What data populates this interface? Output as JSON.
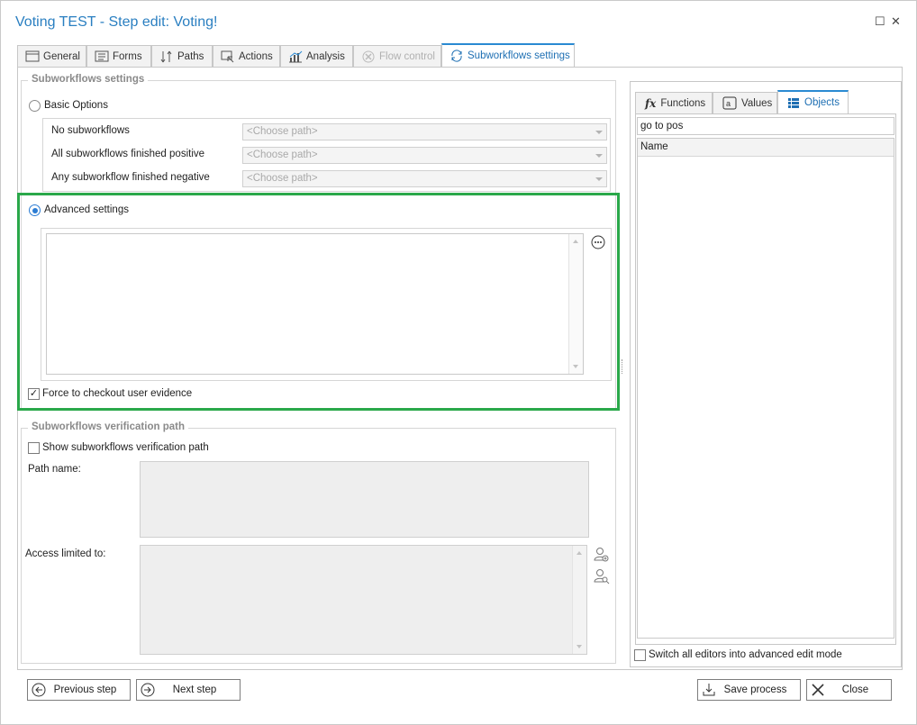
{
  "window": {
    "title": "Voting TEST - Step edit: Voting!",
    "maximize_glyph": "☐",
    "close_glyph": "✕"
  },
  "tabs": [
    {
      "label": "General",
      "icon": "window-icon",
      "state": "normal"
    },
    {
      "label": "Forms",
      "icon": "form-icon",
      "state": "normal"
    },
    {
      "label": "Paths",
      "icon": "paths-icon",
      "state": "normal"
    },
    {
      "label": "Actions",
      "icon": "actions-icon",
      "state": "normal"
    },
    {
      "label": "Analysis",
      "icon": "analysis-icon",
      "state": "normal"
    },
    {
      "label": "Flow control",
      "icon": "flow-control-icon",
      "state": "disabled"
    },
    {
      "label": "Subworkflows settings",
      "icon": "subworkflows-icon",
      "state": "active"
    }
  ],
  "subworkflows_settings": {
    "group_title": "Subworkflows settings",
    "basic_options": {
      "label": "Basic Options",
      "selected": false,
      "rows": [
        {
          "label": "No subworkflows",
          "placeholder": "<Choose path>"
        },
        {
          "label": "All subworkflows finished positive",
          "placeholder": "<Choose path>"
        },
        {
          "label": "Any subworkflow finished negative",
          "placeholder": "<Choose path>"
        }
      ]
    },
    "advanced_settings": {
      "label": "Advanced settings",
      "selected": true,
      "expression_value": ""
    },
    "force_checkout": {
      "label": "Force to checkout user evidence",
      "checked": true,
      "glyph": "✓"
    }
  },
  "verification_path": {
    "group_title": "Subworkflows verification path",
    "show_checkbox": {
      "label": "Show subworkflows verification path",
      "checked": false
    },
    "path_name_label": "Path name:",
    "access_limited_label": "Access limited to:"
  },
  "right_panel": {
    "tabs": [
      {
        "label": "Functions",
        "icon": "function-fx-icon",
        "state": "normal"
      },
      {
        "label": "Values",
        "icon": "values-icon",
        "state": "normal"
      },
      {
        "label": "Objects",
        "icon": "objects-icon",
        "state": "active"
      }
    ],
    "search_value": "go to pos",
    "column_header": "Name",
    "advanced_mode_checkbox": {
      "label": "Switch all editors into advanced edit mode",
      "checked": false
    }
  },
  "footer": {
    "previous_step": "Previous step",
    "next_step": "Next step",
    "save_process": "Save process",
    "close": "Close"
  },
  "colors": {
    "title": "#2a7fc1",
    "highlight_border": "#2aa84a",
    "active_tab_accent": "#2a8ad2"
  }
}
